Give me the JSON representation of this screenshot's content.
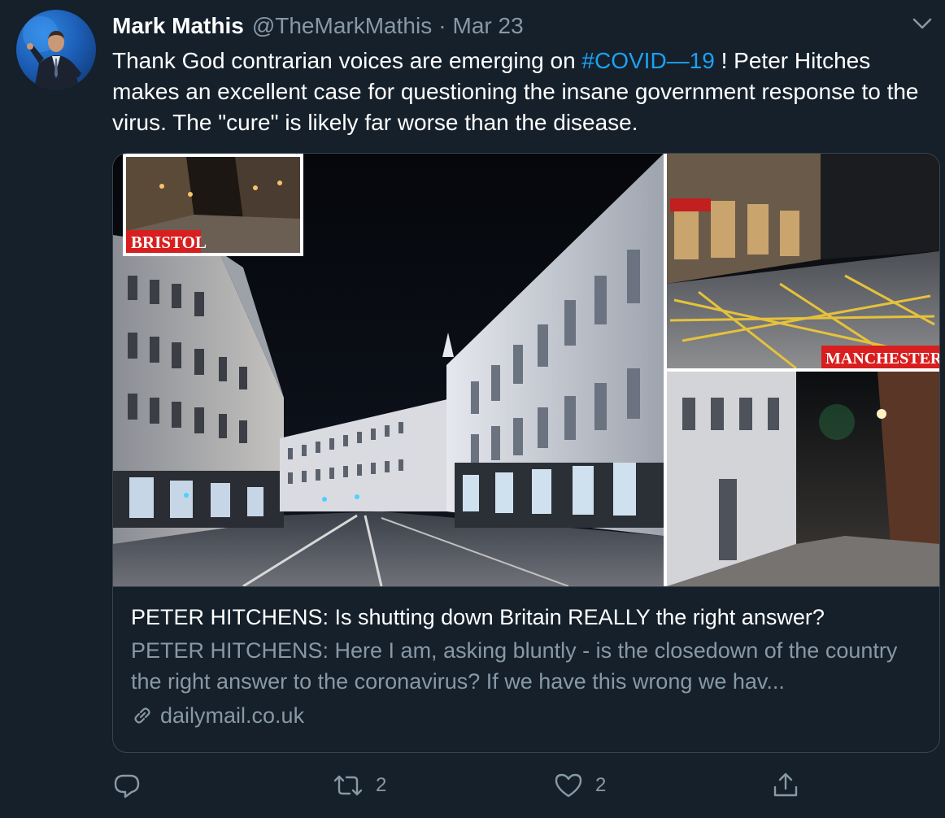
{
  "tweet": {
    "display_name": "Mark Mathis",
    "handle": "@TheMarkMathis",
    "separator": "·",
    "date": "Mar 23",
    "text_before": "Thank God contrarian voices are emerging on ",
    "hashtag": "#COVID—19",
    "text_after": " ! Peter Hitches makes an excellent case for questioning the insane government response to the virus. The \"cure\" is likely far worse than the disease."
  },
  "card": {
    "image_labels": {
      "bristol": "BRISTOL",
      "manchester": "MANCHESTER"
    },
    "title": "PETER HITCHENS: Is shutting down Britain REALLY the right answer?",
    "description": "PETER HITCHENS: Here I am, asking bluntly - is the closedown of the country the right answer to the coronavirus? If we have this wrong we hav...",
    "domain": "dailymail.co.uk"
  },
  "actions": {
    "reply_icon": "reply-icon",
    "retweet_icon": "retweet-icon",
    "retweet_count": "2",
    "like_icon": "heart-icon",
    "like_count": "2",
    "share_icon": "share-icon"
  },
  "colors": {
    "background": "#15202b",
    "text": "#ffffff",
    "secondary_text": "#8899a6",
    "link": "#1da1f2",
    "border": "#38444d",
    "label_red": "#d81e1e"
  }
}
